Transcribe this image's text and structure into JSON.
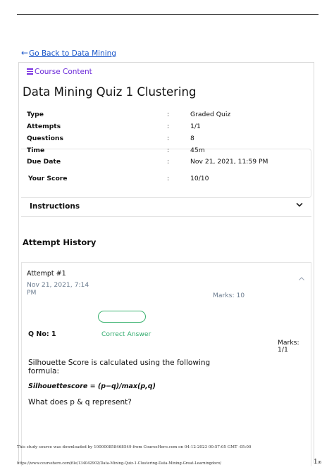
{
  "nav": {
    "back_arrow": "←",
    "back_label": "Go Back to Data Mining"
  },
  "course_content": {
    "icon": "hamburger-menu-icon",
    "label": "Course Content"
  },
  "quiz": {
    "title": "Data Mining Quiz 1 Clustering",
    "info": [
      {
        "label": "Type",
        "colon": ":",
        "value": "Graded Quiz"
      },
      {
        "label": "Attempts",
        "colon": ":",
        "value": "1/1"
      },
      {
        "label": "Questions",
        "colon": ":",
        "value": "8"
      },
      {
        "label": "Time",
        "colon": ":",
        "value": "45m"
      },
      {
        "label": "Due Date",
        "colon": ":",
        "value": "Nov 21, 2021, 11:59 PM"
      },
      {
        "label": "Your Score",
        "colon": ":",
        "value": "10/10"
      }
    ]
  },
  "instructions": {
    "label": "Instructions",
    "icon": "chevron-down-icon"
  },
  "attempt_history": {
    "heading": "Attempt History",
    "attempt": {
      "name": "Attempt #1",
      "date": "Nov 21, 2021, 7:14 PM",
      "marks_total": "Marks: 10",
      "icon": "chevron-up-icon"
    },
    "question": {
      "number": "Q No: 1",
      "status": "Correct Answer",
      "marks_label": "Marks:",
      "marks_value": "1/1",
      "text": "Silhouette Score is calculated using the following formula:",
      "formula": "Silhouettescore = (p−q)/max(p,q)",
      "follow_up": "What does p & q represent?"
    }
  },
  "footer": {
    "study_source": "This study source was downloaded by 100000858468549 from CourseHero.com on 04-12-2023 00:57:05 GMT -05:00",
    "url": "https://www.coursehero.com/file/134042902/Data-Mining-Quiz-1-Clustering-Data-Mining-Great-Learningdocx/",
    "page_current": "1",
    "page_total": "/6"
  },
  "colors": {
    "link": "#1a56c9",
    "course_content": "#6c2bd9",
    "correct": "#2eaa6b",
    "muted": "#6a7b8e"
  }
}
